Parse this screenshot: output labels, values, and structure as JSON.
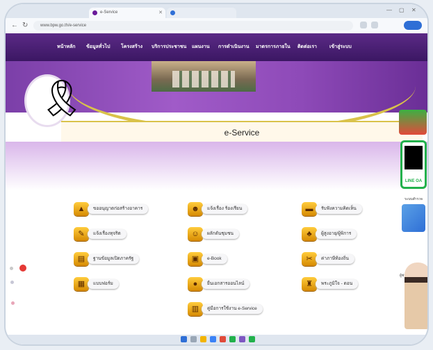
{
  "browser": {
    "tabs": [
      {
        "label": "e-Service"
      },
      {
        "label": ""
      }
    ],
    "url": "www.bpw.go.th/e-service",
    "nav_icons": [
      "back-icon",
      "forward-icon",
      "reload-icon"
    ]
  },
  "site": {
    "menu": [
      {
        "label": "หน้าหลัก"
      },
      {
        "label": "ข้อมูลทั่วไป"
      },
      {
        "label": "โครงสร้าง"
      },
      {
        "label": "บริการประชาชน"
      },
      {
        "label": "แผนงาน"
      },
      {
        "label": "การดำเนินงาน"
      },
      {
        "label": "มาตรการภายใน"
      },
      {
        "label": "ติดต่อเรา"
      },
      {
        "label": "เข้าสู่ระบบ"
      }
    ],
    "page_title": "e-Service"
  },
  "services": {
    "col1": [
      {
        "label": "ขออนุญาตก่อสร้างอาคาร",
        "icon": "building-icon"
      },
      {
        "label": "แจ้งเรื่องทุจริต",
        "icon": "report-icon"
      },
      {
        "label": "ฐานข้อมูลเปิดภาครัฐ",
        "icon": "database-icon"
      },
      {
        "label": "แบบฟอร์ม",
        "icon": "form-icon"
      }
    ],
    "col2": [
      {
        "label": "แจ้งเรื่อง ร้องเรียน",
        "icon": "complaint-icon"
      },
      {
        "label": "ผลักดันชุมชน",
        "icon": "community-icon"
      },
      {
        "label": "e-Book",
        "icon": "book-icon"
      },
      {
        "label": "ยื่นเอกสารออนไลน์",
        "icon": "upload-icon"
      },
      {
        "label": "คู่มือการใช้งาน e-Service",
        "icon": "manual-icon"
      }
    ],
    "col3": [
      {
        "label": "รับฟังความคิดเห็น",
        "icon": "feedback-icon"
      },
      {
        "label": "ผู้สูงอายุ/ผู้พิการ",
        "icon": "elder-icon"
      },
      {
        "label": "ค่าภาษีท้องถิ่น",
        "icon": "tax-icon"
      },
      {
        "label": "พระภูมิใจ - ดอน",
        "icon": "temple-icon"
      }
    ]
  },
  "sidebar": {
    "line_label": "LINE OA",
    "survey_label": "ระบบสำรวจ",
    "assistant_label": "ผู้ช่วย"
  },
  "colors": {
    "nav": "#4a1f78",
    "accent_gold": "#d9c24a",
    "icon_gold": "#f0a800",
    "line_green": "#22b14c"
  }
}
